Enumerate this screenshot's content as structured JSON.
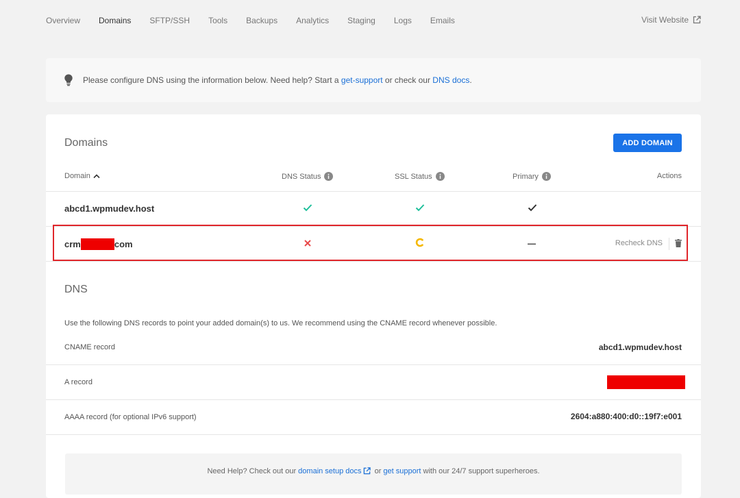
{
  "nav": {
    "tabs": [
      "Overview",
      "Domains",
      "SFTP/SSH",
      "Tools",
      "Backups",
      "Analytics",
      "Staging",
      "Logs",
      "Emails"
    ],
    "active_tab": "Domains",
    "visit_website": "Visit Website"
  },
  "notice": {
    "text_before": "Please configure DNS using the information below. Need help? Start a ",
    "link1": "get-support",
    "text_middle": " or check our ",
    "link2": "DNS docs",
    "text_after": "."
  },
  "domains": {
    "title": "Domains",
    "add_button": "ADD DOMAIN",
    "columns": {
      "domain": "Domain",
      "dns_status": "DNS Status",
      "ssl_status": "SSL Status",
      "primary": "Primary",
      "actions": "Actions"
    },
    "rows": [
      {
        "name": "abcd1.wpmudev.host",
        "dns": "check",
        "ssl": "check",
        "primary": "check"
      },
      {
        "name_prefix": "crm",
        "name_suffix": "com",
        "dns": "cross",
        "ssl": "pending",
        "primary": "dash",
        "action": "Recheck DNS"
      }
    ]
  },
  "dns": {
    "title": "DNS",
    "description": "Use the following DNS records to point your added domain(s) to us. We recommend using the CNAME record whenever possible.",
    "records": [
      {
        "label": "CNAME record",
        "value": "abcd1.wpmudev.host"
      },
      {
        "label": "A record",
        "value": ""
      },
      {
        "label": "AAAA record (for optional IPv6 support)",
        "value": "2604:a880:400:d0::19f7:e001"
      }
    ]
  },
  "help": {
    "text_before": "Need Help? Check out our ",
    "link1": "domain setup docs",
    "text_middle": " or ",
    "link2": "get support",
    "text_after": " with our 24/7 support superheroes."
  },
  "colors": {
    "accent": "#1a73e8",
    "success": "#1dbf9a",
    "error": "#e8484a",
    "warning": "#f5b800",
    "highlight": "#e0252a",
    "redaction": "#ee0000"
  }
}
